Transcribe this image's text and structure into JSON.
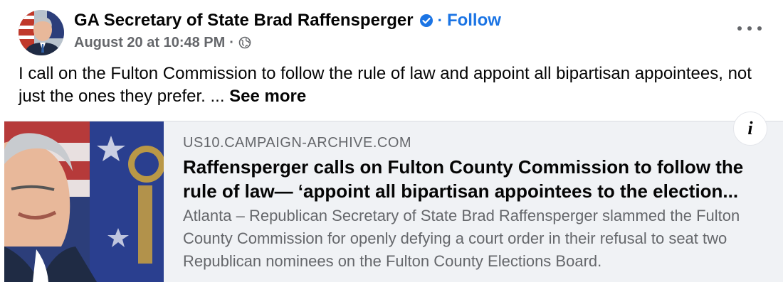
{
  "post": {
    "author": "GA Secretary of State Brad Raffensperger",
    "follow_label": "Follow",
    "timestamp": "August 20 at 10:48 PM",
    "audience_icon": "globe-icon",
    "verified_icon": "verified-badge-icon",
    "more_icon": "more-options-icon",
    "text": "I call on the Fulton Commission to follow the rule of law and appoint all bipartisan appointees, not just the ones they prefer. ... ",
    "see_more_label": "See more"
  },
  "link_preview": {
    "domain": "US10.CAMPAIGN-ARCHIVE.COM",
    "headline": "Raffensperger calls on Fulton County Commission to follow the rule of law— ‘appoint all bipartisan appointees to the election...",
    "description": "Atlanta – Republican Secretary of State Brad Raffensperger slammed the Fulton County Commission for openly defying a court order in their refusal to seat two Republican nominees on the Fulton County Elections Board.",
    "info_icon": "info-icon",
    "info_label": "i"
  },
  "colors": {
    "accent": "#1b74e4",
    "secondary_text": "#65676b",
    "preview_bg": "#f0f2f5"
  }
}
